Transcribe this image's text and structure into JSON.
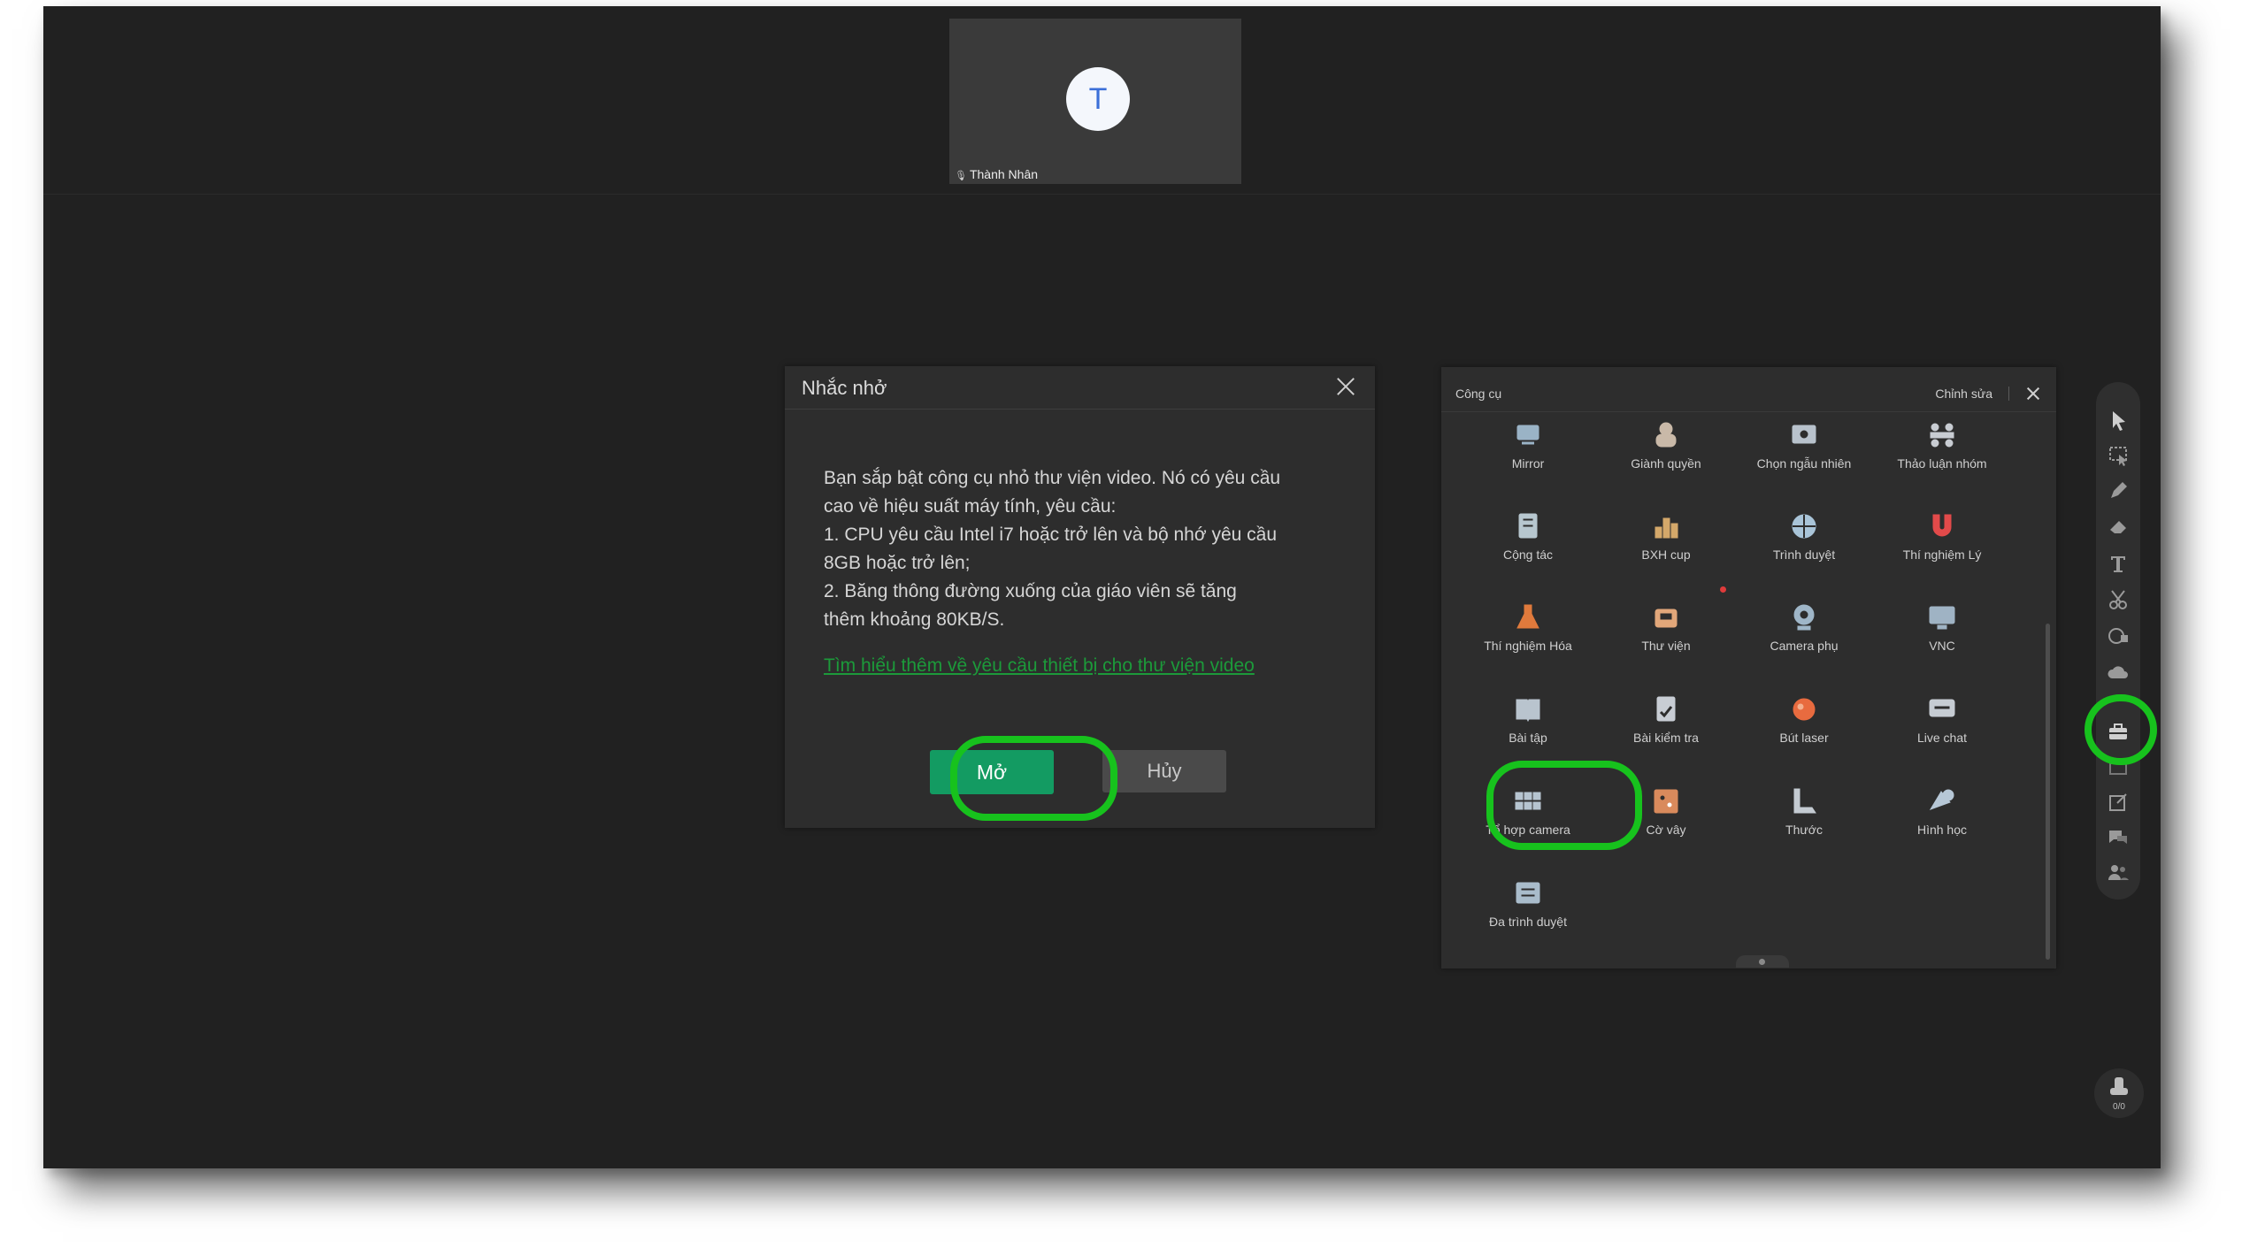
{
  "participant": {
    "initial": "T",
    "name": "Thành Nhân"
  },
  "dialog": {
    "title": "Nhắc nhở",
    "lines": [
      "Bạn sắp bật công cụ nhỏ thư viện video. Nó có yêu cầu",
      "cao về hiệu suất máy tính, yêu cầu:",
      "1. CPU yêu cầu Intel i7 hoặc trở lên và bộ nhớ yêu cầu",
      "8GB hoặc trở lên;",
      "2. Băng thông đường xuống của giáo viên sẽ tăng",
      "thêm khoảng 80KB/S."
    ],
    "link": "Tìm hiểu thêm về yêu cầu thiết bị cho thư viện video",
    "open_label": "Mở",
    "cancel_label": "Hủy"
  },
  "tools_panel": {
    "title": "Công cụ",
    "edit_label": "Chỉnh sửa",
    "items": [
      {
        "label": "Mirror",
        "icon": "mirror-icon",
        "color": "#9ab3c6"
      },
      {
        "label": "Giành quyền",
        "icon": "grab-icon",
        "color": "#c9b9a8"
      },
      {
        "label": "Chọn ngẫu nhiên",
        "icon": "random-pick-icon",
        "color": "#b8c2cc"
      },
      {
        "label": "Thảo luận nhóm",
        "icon": "group-discussion-icon",
        "color": "#c8ccd2"
      },
      {
        "label": "Cộng tác",
        "icon": "collaborate-icon",
        "color": "#b7c7cf"
      },
      {
        "label": "BXH cup",
        "icon": "leaderboard-icon",
        "color": "#d4a86a"
      },
      {
        "label": "Trình duyệt",
        "icon": "browser-icon",
        "color": "#a9c4d8"
      },
      {
        "label": "Thí nghiệm Lý",
        "icon": "magnet-icon",
        "color": "#e24a4a"
      },
      {
        "label": "Thí nghiệm Hóa",
        "icon": "flask-icon",
        "color": "#e07a3c"
      },
      {
        "label": "Thư viện",
        "icon": "library-icon",
        "color": "#e2a77a"
      },
      {
        "label": "Camera phụ",
        "icon": "webcam-icon",
        "color": "#9fb6c8"
      },
      {
        "label": "VNC",
        "icon": "vnc-icon",
        "color": "#9fb3c4"
      },
      {
        "label": "Bài tập",
        "icon": "homework-icon",
        "color": "#b9c4ce"
      },
      {
        "label": "Bài kiểm tra",
        "icon": "test-icon",
        "color": "#c8cdd4"
      },
      {
        "label": "Bút laser",
        "icon": "laser-pen-icon",
        "color": "#e86b3f"
      },
      {
        "label": "Live chat",
        "icon": "live-chat-icon",
        "color": "#c6ccd3"
      },
      {
        "label": "Tổ hợp camera",
        "icon": "camera-grid-icon",
        "color": "#b6c4d0"
      },
      {
        "label": "Cờ vây",
        "icon": "go-board-icon",
        "color": "#d98a5c"
      },
      {
        "label": "Thước",
        "icon": "ruler-icon",
        "color": "#c4cbd2"
      },
      {
        "label": "Hình học",
        "icon": "geometry-icon",
        "color": "#b6c7d6"
      },
      {
        "label": "Đa trình duyệt",
        "icon": "multi-browser-icon",
        "color": "#a9bccb"
      }
    ]
  },
  "right_toolbar": {
    "items": [
      "cursor-icon",
      "select-icon",
      "pen-icon",
      "eraser-icon",
      "text-icon",
      "scissors-icon",
      "shape-icon",
      "cloud-icon",
      "toolbox-icon",
      "pages-icon",
      "edit-icon",
      "chat-icon",
      "users-icon"
    ],
    "counter": "0/0"
  },
  "colors": {
    "highlight": "#17c21d",
    "primary": "#139b62",
    "link": "#1c9a3a"
  }
}
